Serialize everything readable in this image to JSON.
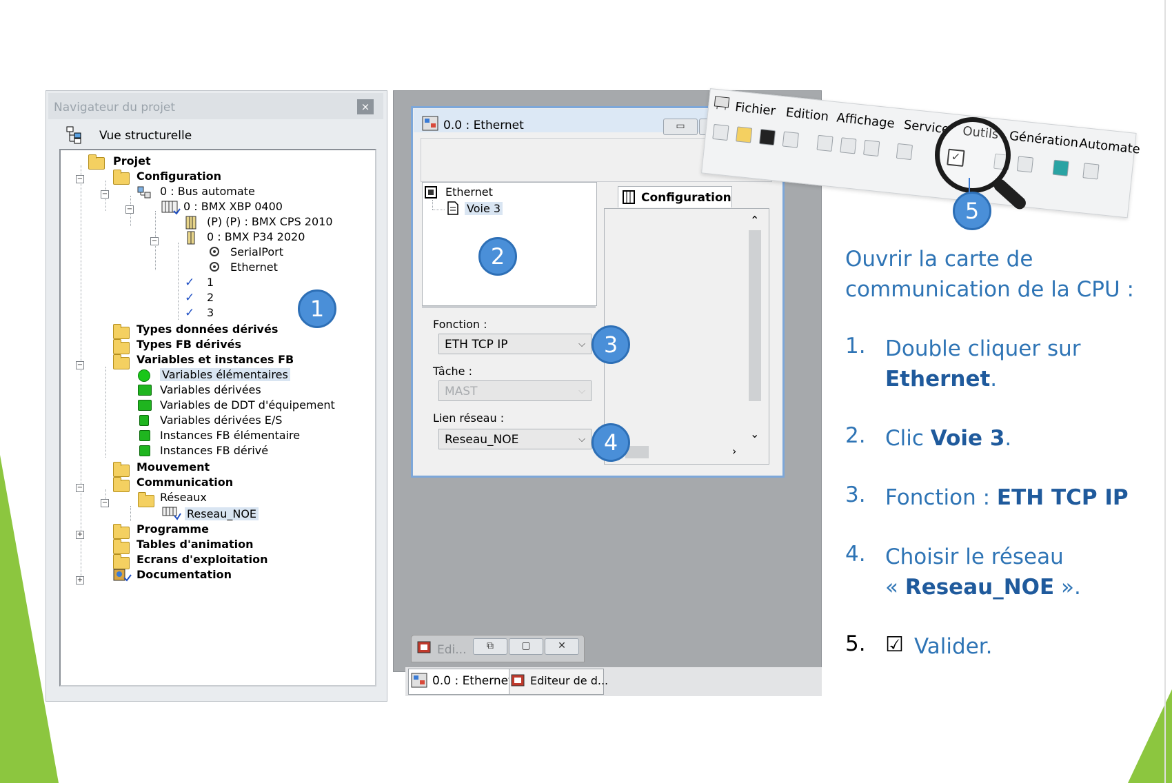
{
  "navigator": {
    "title": "Navigateur du projet",
    "close": "×",
    "view_label": "Vue structurelle",
    "items": [
      {
        "label": "Projet",
        "bold": true
      },
      {
        "label": "Configuration",
        "bold": true
      },
      {
        "label": "0 : Bus automate",
        "bold": false
      },
      {
        "label": "0 : BMX XBP 0400",
        "bold": false
      },
      {
        "label": "(P) (P) : BMX CPS 2010",
        "bold": false
      },
      {
        "label": "0 : BMX P34 2020",
        "bold": false
      },
      {
        "label": "SerialPort",
        "bold": false
      },
      {
        "label": "Ethernet",
        "bold": false
      },
      {
        "label": "1",
        "bold": false
      },
      {
        "label": "2",
        "bold": false
      },
      {
        "label": "3",
        "bold": false
      },
      {
        "label": "Types données dérivés",
        "bold": true
      },
      {
        "label": "Types FB dérivés",
        "bold": true
      },
      {
        "label": "Variables et instances FB",
        "bold": true
      },
      {
        "label": "Variables élémentaires",
        "bold": false
      },
      {
        "label": "Variables dérivées",
        "bold": false
      },
      {
        "label": "Variables de DDT d'équipement",
        "bold": false
      },
      {
        "label": "Variables dérivées E/S",
        "bold": false
      },
      {
        "label": "Instances FB élémentaire",
        "bold": false
      },
      {
        "label": "Instances FB dérivé",
        "bold": false
      },
      {
        "label": "Mouvement",
        "bold": true
      },
      {
        "label": "Communication",
        "bold": true
      },
      {
        "label": "Réseaux",
        "bold": false
      },
      {
        "label": "Reseau_NOE",
        "bold": false
      },
      {
        "label": "Programme",
        "bold": true
      },
      {
        "label": "Tables d'animation",
        "bold": true
      },
      {
        "label": "Ecrans d'exploitation",
        "bold": true
      },
      {
        "label": "Documentation",
        "bold": true
      }
    ]
  },
  "ethernet_window": {
    "title": "0.0 : Ethernet",
    "tree_root": "Ethernet",
    "tree_child": "Voie 3",
    "config_tab": "Configuration",
    "fonction_label": "Fonction :",
    "fonction_value": "ETH TCP IP",
    "tache_label": "Tâche :",
    "tache_value": "MAST",
    "lien_label": "Lien réseau :",
    "lien_value": "Reseau_NOE"
  },
  "mini_window": {
    "label": "Edi..."
  },
  "tabs": [
    {
      "label": "0.0 : Ethernet",
      "active": true
    },
    {
      "label": "Editeur de d...",
      "active": false
    }
  ],
  "menu": {
    "items": [
      "Fichier",
      "Edition",
      "Affichage",
      "Service",
      "Outils",
      "Génération",
      "Automate"
    ]
  },
  "badges": [
    "1",
    "2",
    "3",
    "4",
    "5"
  ],
  "instructions": {
    "intro_line1": "Ouvrir la carte de",
    "intro_line2": "communication de la CPU :",
    "step1_num": "1.",
    "step1_text": "Double cliquer sur",
    "step1_bold": "Ethernet",
    "step1_end": ".",
    "step2_num": "2.",
    "step2_text": "Clic ",
    "step2_bold": "Voie 3",
    "step2_end": ".",
    "step3_num": "3.",
    "step3_text": "Fonction : ",
    "step3_bold": "ETH TCP IP",
    "step4_num": "4.",
    "step4_text": "Choisir le réseau",
    "step4_open": "« ",
    "step4_bold": "Reseau_NOE",
    "step4_close": " ».",
    "step5_num": "5.",
    "step5_icon": "☑",
    "step5_text": "Valider."
  },
  "colors": {
    "instruction_blue": "#2e74b5",
    "badge_blue": "#4a8fd8",
    "slide_green": "#8cc63f"
  }
}
